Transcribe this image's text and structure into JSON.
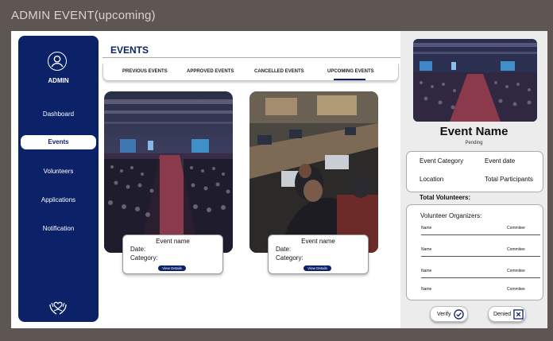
{
  "frame_title": "ADMIN EVENT(upcoming)",
  "sidebar": {
    "admin_label": "ADMIN",
    "items": [
      {
        "label": "Dashboard"
      },
      {
        "label": "Events"
      },
      {
        "label": "Volunteers"
      },
      {
        "label": "Applications"
      },
      {
        "label": "Notification"
      }
    ],
    "active_item": "Events"
  },
  "main": {
    "title": "EVENTS",
    "tabs": [
      {
        "label": "PREVIOUS EVENTS"
      },
      {
        "label": "APPROVED EVENTS"
      },
      {
        "label": "CANCELLED EVENTS"
      },
      {
        "label": "UPCOMING EVENTS"
      }
    ],
    "active_tab": "UPCOMING EVENTS",
    "cards": [
      {
        "name": "Event name",
        "date_label": "Date:",
        "category_label": "Category:",
        "button": "View Details"
      },
      {
        "name": "Event name",
        "date_label": "Date:",
        "category_label": "Category:",
        "button": "View Details"
      }
    ]
  },
  "detail": {
    "event_name": "Event Name",
    "status": "Pending",
    "event_category": "Event Category",
    "event_date": "Event date",
    "location": "Location",
    "total_participants": "Total Participants",
    "total_volunteers": "Total Volunteers:",
    "volunteer_organizers_title": "Volunteer Organizers:",
    "organizers": [
      {
        "name": "Name",
        "role": "Commitee"
      },
      {
        "name": "Name",
        "role": "Commitee"
      },
      {
        "name": "Name",
        "role": "Commitee"
      },
      {
        "name": "Name",
        "role": "Commitee"
      }
    ],
    "verify_label": "Verify",
    "denied_label": "Denied"
  },
  "colors": {
    "brand_navy": "#0b2269",
    "frame_bg": "#5e5652",
    "panel_bg": "#ececec"
  },
  "icons": {
    "avatar": "user-circle-icon",
    "logo": "hands-heart-logo-icon",
    "verify": "check-circle-icon",
    "denied": "x-square-icon"
  }
}
